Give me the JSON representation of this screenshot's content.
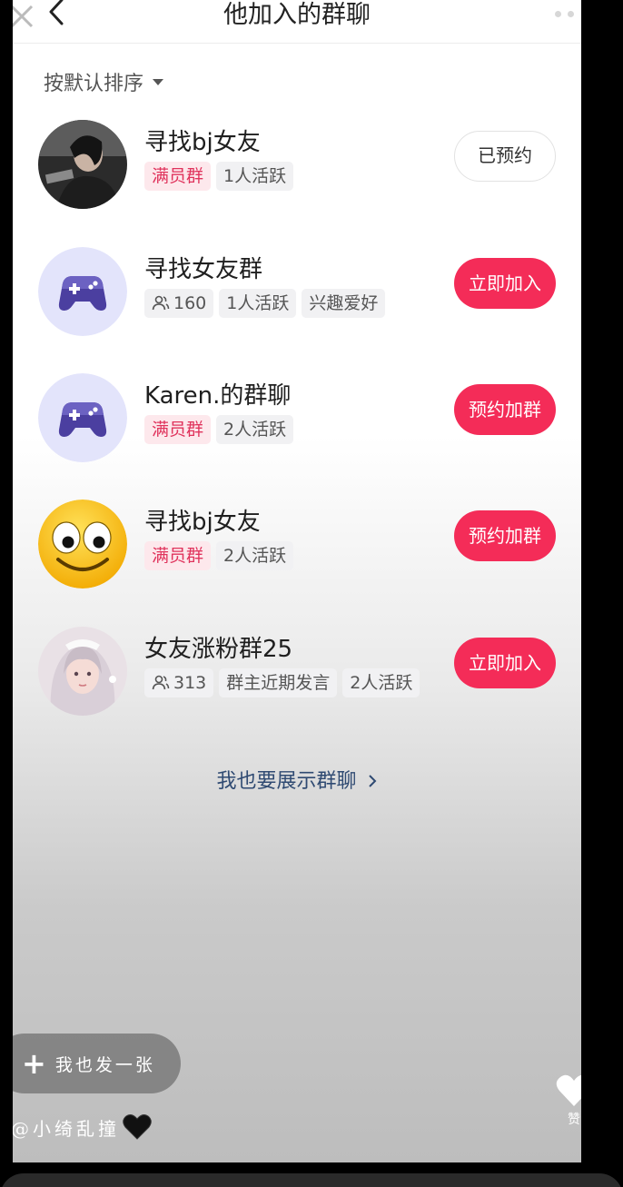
{
  "header": {
    "title": "他加入的群聊"
  },
  "sort": {
    "label": "按默认排序"
  },
  "groups": [
    {
      "name": "寻找bj女友",
      "tags": [
        {
          "text": "满员群",
          "style": "pink"
        },
        {
          "text": "1人活跃"
        }
      ],
      "button": "已预约",
      "button_style": "outline",
      "avatar": "dark-photo"
    },
    {
      "name": "寻找女友群",
      "members": "160",
      "tags": [
        {
          "text": "1人活跃"
        },
        {
          "text": "兴趣爱好"
        }
      ],
      "button": "立即加入",
      "button_style": "solid",
      "avatar": "gamepad-icon"
    },
    {
      "name": "Karen.的群聊",
      "tags": [
        {
          "text": "满员群",
          "style": "pink"
        },
        {
          "text": "2人活跃"
        }
      ],
      "button": "预约加群",
      "button_style": "solid",
      "avatar": "gamepad-icon"
    },
    {
      "name": "寻找bj女友",
      "tags": [
        {
          "text": "满员群",
          "style": "pink"
        },
        {
          "text": "2人活跃"
        }
      ],
      "button": "预约加群",
      "button_style": "solid",
      "avatar": "smiley-emoji"
    },
    {
      "name": "女友涨粉群25",
      "members": "313",
      "tags": [
        {
          "text": "群主近期发言"
        },
        {
          "text": "2人活跃"
        }
      ],
      "button": "立即加入",
      "button_style": "solid",
      "avatar": "girl-photo"
    }
  ],
  "footer": {
    "show_link": "我也要展示群聊"
  },
  "overlay": {
    "fab_label": "我也发一张",
    "author": "@小绮乱撞",
    "like_label": "赞"
  },
  "colors": {
    "accent": "#f42c58",
    "pink_tag_bg": "#fde8ec",
    "pink_tag_text": "#e0345d",
    "link": "#2f4a72"
  }
}
